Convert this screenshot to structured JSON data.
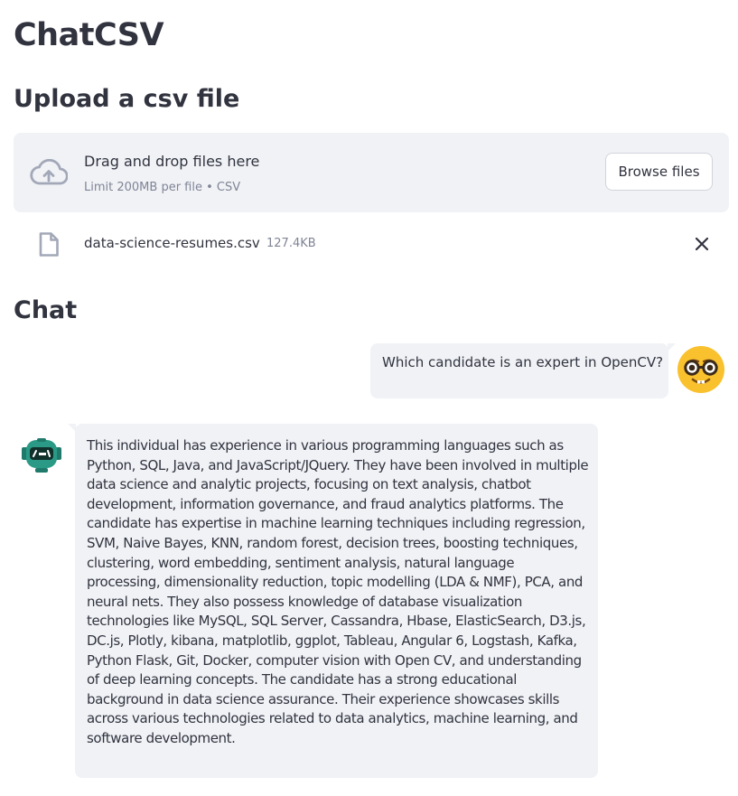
{
  "app": {
    "title": "ChatCSV"
  },
  "upload": {
    "section_title": "Upload a csv file",
    "dropzone_text": "Drag and drop files here",
    "dropzone_hint": "Limit 200MB per file • CSV",
    "browse_label": "Browse files",
    "icon": "cloud-upload-icon"
  },
  "file": {
    "name": "data-science-resumes.csv",
    "size": "127.4KB",
    "icon": "file-icon",
    "remove_icon": "close-icon"
  },
  "chat": {
    "section_title": "Chat",
    "messages": [
      {
        "role": "user",
        "avatar": "nerd-face-emoji",
        "text": "Which candidate is an expert in OpenCV?"
      },
      {
        "role": "assistant",
        "avatar": "robot-avatar",
        "text": "This individual has experience in various programming languages such as Python, SQL, Java, and JavaScript/JQuery. They have been involved in multiple data science and analytic projects, focusing on text analysis, chatbot development, information governance, and fraud analytics platforms. The candidate has expertise in machine learning techniques including regression, SVM, Naive Bayes, KNN, random forest, decision trees, boosting techniques, clustering, word embedding, sentiment analysis, natural language processing, dimensionality reduction, topic modelling (LDA & NMF), PCA, and neural nets. They also possess knowledge of database visualization technologies like MySQL, SQL Server, Cassandra, Hbase, ElasticSearch, D3.js, DC.js, Plotly, kibana, matplotlib, ggplot, Tableau, Angular 6, Logstash, Kafka, Python Flask, Git, Docker, computer vision with Open CV, and understanding of deep learning concepts. The candidate has a strong educational background in data science assurance. Their experience showcases skills across various technologies related to data analytics, machine learning, and software development."
      }
    ]
  },
  "colors": {
    "text": "#31333f",
    "muted": "#808495",
    "panel": "#f0f2f6",
    "icon": "#a3a8b8"
  }
}
